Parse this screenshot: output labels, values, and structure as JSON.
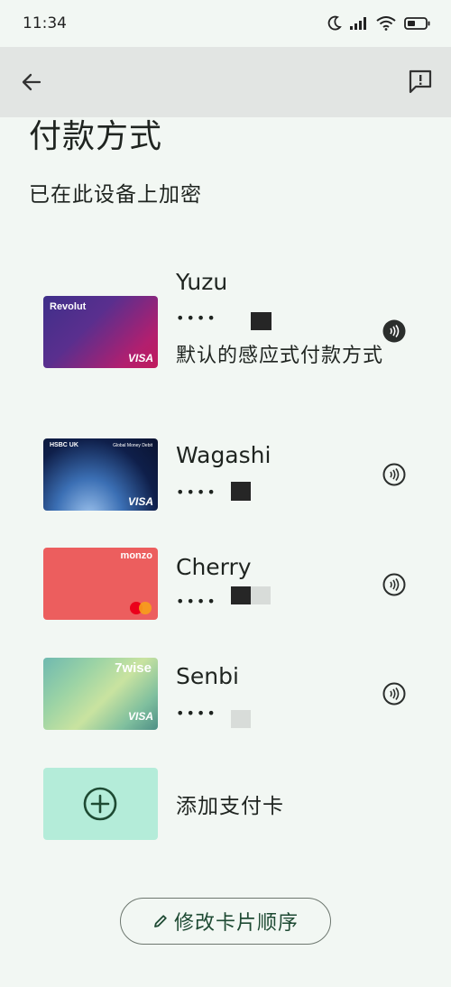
{
  "status_bar": {
    "time": "11:34"
  },
  "header": {
    "title": "付款方式",
    "subtitle": "已在此设备上加密"
  },
  "cards": [
    {
      "name": "Yuzu",
      "number_masked": "••••",
      "brand_text": "Revolut",
      "network": "VISA",
      "default_label": "默认的感应式付款方式"
    },
    {
      "name": "Wagashi",
      "number_masked": "••••",
      "brand_text": "HSBC UK",
      "brand_sub": "Global Money Debit",
      "network": "VISA"
    },
    {
      "name": "Cherry",
      "number_masked": "••••",
      "brand_text": "monzo"
    },
    {
      "name": "Senbi",
      "number_masked": "••••",
      "brand_text": "7wise",
      "network": "VISA"
    }
  ],
  "add_card": {
    "label": "添加支付卡"
  },
  "reorder_button": {
    "label": "修改卡片顺序"
  },
  "colors": {
    "accent_green": "#1e4a33",
    "add_tile": "#b4ecd9",
    "background": "#f2f7f3",
    "app_bar": "#e2e5e3"
  }
}
